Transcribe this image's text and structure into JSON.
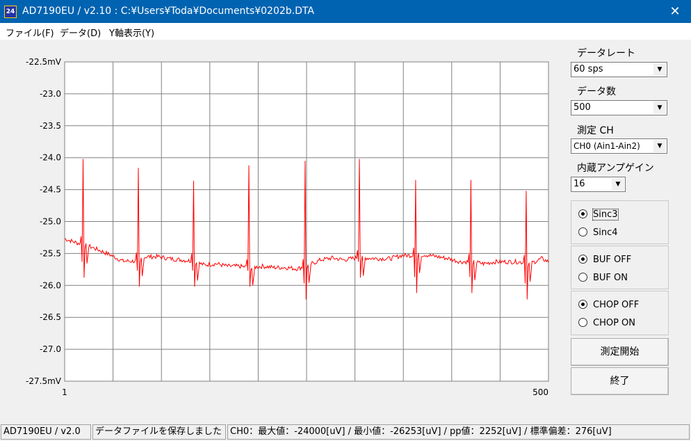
{
  "window": {
    "title": "AD7190EU / v2.10 : C:¥Users¥Toda¥Documents¥0202b.DTA",
    "icon": "24"
  },
  "menu": [
    {
      "label": "ファイル(F)"
    },
    {
      "label": "データ(D)"
    },
    {
      "label": "Y軸表示(Y)"
    }
  ],
  "chart_data": {
    "type": "line",
    "y_ticks": [
      "-22.5mV",
      "-23.0",
      "-23.5",
      "-24.0",
      "-24.5",
      "-25.0",
      "-25.5",
      "-26.0",
      "-26.5",
      "-27.0",
      "-27.5mV"
    ],
    "x_ticks": [
      "1",
      "500"
    ],
    "ylim": [
      -27.5,
      -22.5
    ],
    "xlim": [
      1,
      500
    ],
    "grid": true,
    "color": "#ff0000",
    "baseline": [
      [
        1,
        -25.27
      ],
      [
        13,
        -25.33
      ],
      [
        25,
        -25.38
      ],
      [
        37,
        -25.45
      ],
      [
        49,
        -25.53
      ],
      [
        61,
        -25.62
      ],
      [
        73,
        -25.62
      ],
      [
        85,
        -25.55
      ],
      [
        97,
        -25.55
      ],
      [
        109,
        -25.58
      ],
      [
        121,
        -25.6
      ],
      [
        133,
        -25.62
      ],
      [
        145,
        -25.68
      ],
      [
        157,
        -25.66
      ],
      [
        169,
        -25.7
      ],
      [
        181,
        -25.7
      ],
      [
        193,
        -25.72
      ],
      [
        205,
        -25.7
      ],
      [
        217,
        -25.72
      ],
      [
        229,
        -25.72
      ],
      [
        241,
        -25.74
      ],
      [
        253,
        -25.68
      ],
      [
        265,
        -25.6
      ],
      [
        277,
        -25.57
      ],
      [
        289,
        -25.6
      ],
      [
        301,
        -25.57
      ],
      [
        313,
        -25.57
      ],
      [
        325,
        -25.58
      ],
      [
        337,
        -25.58
      ],
      [
        349,
        -25.53
      ],
      [
        361,
        -25.53
      ],
      [
        373,
        -25.52
      ],
      [
        385,
        -25.55
      ],
      [
        397,
        -25.58
      ],
      [
        409,
        -25.63
      ],
      [
        421,
        -25.63
      ],
      [
        433,
        -25.66
      ],
      [
        445,
        -25.63
      ],
      [
        457,
        -25.63
      ],
      [
        469,
        -25.63
      ],
      [
        481,
        -25.66
      ],
      [
        493,
        -25.58
      ],
      [
        500,
        -25.63
      ]
    ],
    "beats": [
      {
        "x": 20,
        "peak": -24.02,
        "dip": -25.88
      },
      {
        "x": 77,
        "peak": -24.16,
        "dip": -26.02
      },
      {
        "x": 134,
        "peak": -24.36,
        "dip": -26.02
      },
      {
        "x": 191,
        "peak": -24.12,
        "dip": -26.02
      },
      {
        "x": 249,
        "peak": -24.05,
        "dip": -26.22
      },
      {
        "x": 305,
        "peak": -24.02,
        "dip": -25.88
      },
      {
        "x": 363,
        "peak": -24.35,
        "dip": -26.12
      },
      {
        "x": 420,
        "peak": -24.35,
        "dip": -26.12
      },
      {
        "x": 477,
        "peak": -24.52,
        "dip": -26.22
      }
    ]
  },
  "controls": {
    "data_rate": {
      "label": "データレート",
      "value": "60 sps"
    },
    "data_count": {
      "label": "データ数",
      "value": "500"
    },
    "channel": {
      "label": "測定 CH",
      "value": "CH0 (Ain1-Ain2)"
    },
    "gain": {
      "label": "内蔵アンプゲイン",
      "value": "16"
    },
    "filter": {
      "option1": "Sinc3",
      "option2": "Sinc4",
      "selected": "Sinc3"
    },
    "buf": {
      "option1": "BUF OFF",
      "option2": "BUF ON",
      "selected": "BUF OFF"
    },
    "chop": {
      "option1": "CHOP OFF",
      "option2": "CHOP ON",
      "selected": "CHOP OFF"
    },
    "start_label": "測定開始",
    "exit_label": "終了"
  },
  "status": {
    "panel1": "AD7190EU / v2.0",
    "panel2": "データファイルを保存しました",
    "panel3": "CH0：最大値：-24000[uV] / 最小値：-26253[uV] / pp値：2252[uV] / 標準偏差：276[uV]"
  }
}
